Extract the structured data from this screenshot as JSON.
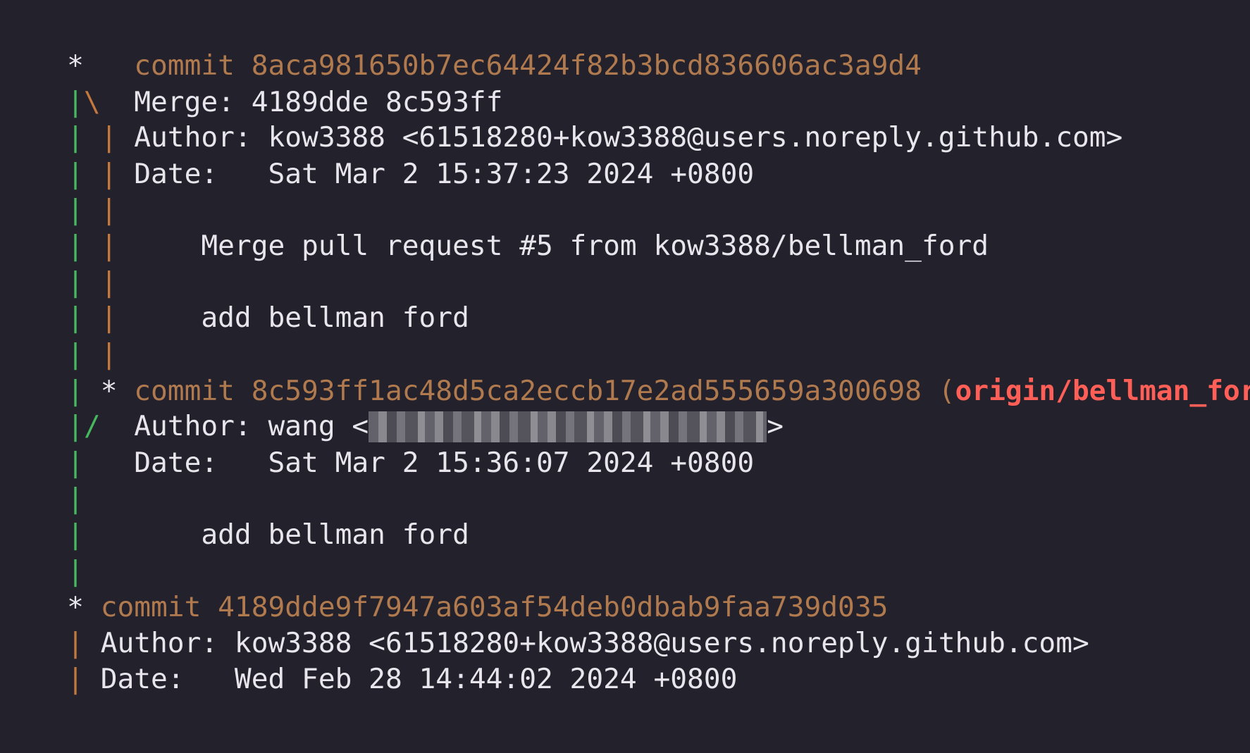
{
  "terminal": {
    "commits": [
      {
        "hash": "commit 8aca981650b7ec64424f82b3bcd836606ac3a9d4",
        "merge": "Merge: 4189dde 8c593ff",
        "author": "Author: kow3388 <61518280+kow3388@users.noreply.github.com>",
        "date": "Date:   Sat Mar 2 15:37:23 2024 +0800",
        "message_lines": [
          "Merge pull request #5 from kow3388/bellman_ford",
          "add bellman ford"
        ]
      },
      {
        "hash": "commit 8c593ff1ac48d5ca2eccb17e2ad555659a300698",
        "ref_open": "(",
        "ref": "origin/bellman_ford",
        "ref_close": ")",
        "author_prefix": "Author: wang <",
        "author_suffix": ">",
        "date": "Date:   Sat Mar 2 15:36:07 2024 +0800",
        "message_lines": [
          "add bellman ford"
        ]
      },
      {
        "hash": "commit 4189dde9f7947a603af54deb0dbab9faa739d035",
        "author": "Author: kow3388 <61518280+kow3388@users.noreply.github.com>",
        "date": "Date:   Wed Feb 28 14:44:02 2024 +0800"
      }
    ],
    "graph": {
      "star": "*",
      "pipe": "|",
      "backslash": "\\",
      "slash": "/"
    }
  }
}
